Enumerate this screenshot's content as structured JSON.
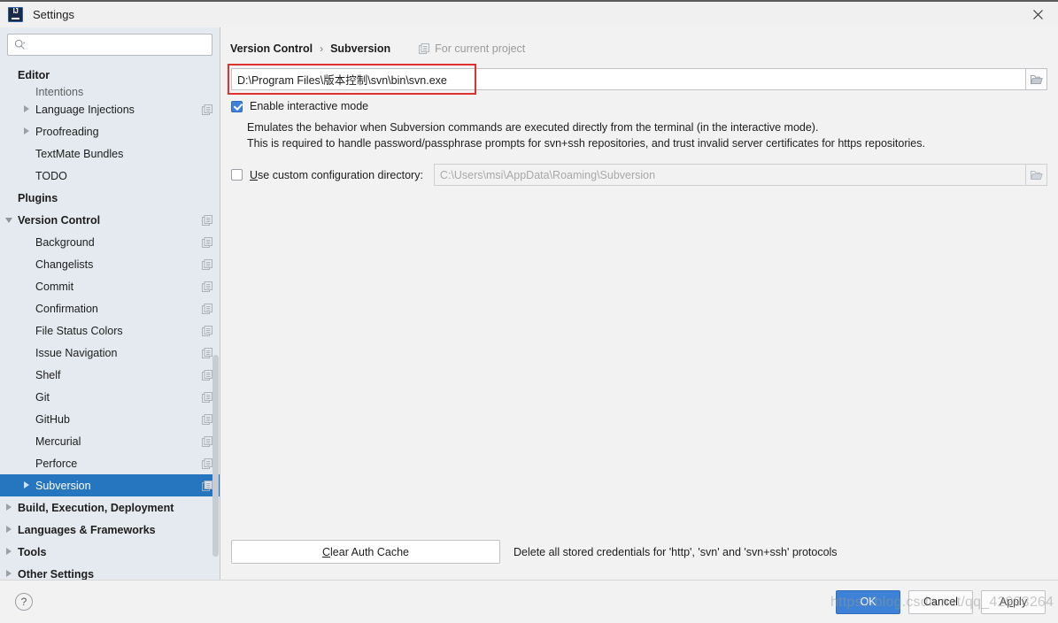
{
  "window": {
    "title": "Settings",
    "logo_icon": "intellij-idea-logo",
    "close_icon": "close-icon"
  },
  "sidebar": {
    "search": {
      "placeholder": "",
      "value": "",
      "icon": "search-icon"
    },
    "scope_icon": "project-scope-icon",
    "items": [
      {
        "label": "Editor",
        "level": 0,
        "arrow": "none",
        "bold": true,
        "scope": false,
        "selected": false
      },
      {
        "label": "Intentions",
        "level": 1,
        "arrow": "none",
        "bold": false,
        "scope": false,
        "selected": false,
        "clipped": true
      },
      {
        "label": "Language Injections",
        "level": 1,
        "arrow": "right",
        "bold": false,
        "scope": true,
        "selected": false
      },
      {
        "label": "Proofreading",
        "level": 1,
        "arrow": "right",
        "bold": false,
        "scope": false,
        "selected": false
      },
      {
        "label": "TextMate Bundles",
        "level": 1,
        "arrow": "none",
        "bold": false,
        "scope": false,
        "selected": false
      },
      {
        "label": "TODO",
        "level": 1,
        "arrow": "none",
        "bold": false,
        "scope": false,
        "selected": false
      },
      {
        "label": "Plugins",
        "level": 0,
        "arrow": "none",
        "bold": true,
        "scope": false,
        "selected": false
      },
      {
        "label": "Version Control",
        "level": 0,
        "arrow": "down",
        "bold": true,
        "scope": true,
        "selected": false
      },
      {
        "label": "Background",
        "level": 1,
        "arrow": "none",
        "bold": false,
        "scope": true,
        "selected": false
      },
      {
        "label": "Changelists",
        "level": 1,
        "arrow": "none",
        "bold": false,
        "scope": true,
        "selected": false
      },
      {
        "label": "Commit",
        "level": 1,
        "arrow": "none",
        "bold": false,
        "scope": true,
        "selected": false
      },
      {
        "label": "Confirmation",
        "level": 1,
        "arrow": "none",
        "bold": false,
        "scope": true,
        "selected": false
      },
      {
        "label": "File Status Colors",
        "level": 1,
        "arrow": "none",
        "bold": false,
        "scope": true,
        "selected": false
      },
      {
        "label": "Issue Navigation",
        "level": 1,
        "arrow": "none",
        "bold": false,
        "scope": true,
        "selected": false
      },
      {
        "label": "Shelf",
        "level": 1,
        "arrow": "none",
        "bold": false,
        "scope": true,
        "selected": false
      },
      {
        "label": "Git",
        "level": 1,
        "arrow": "none",
        "bold": false,
        "scope": true,
        "selected": false
      },
      {
        "label": "GitHub",
        "level": 1,
        "arrow": "none",
        "bold": false,
        "scope": true,
        "selected": false
      },
      {
        "label": "Mercurial",
        "level": 1,
        "arrow": "none",
        "bold": false,
        "scope": true,
        "selected": false
      },
      {
        "label": "Perforce",
        "level": 1,
        "arrow": "none",
        "bold": false,
        "scope": true,
        "selected": false
      },
      {
        "label": "Subversion",
        "level": 1,
        "arrow": "right",
        "bold": false,
        "scope": true,
        "selected": true
      },
      {
        "label": "Build, Execution, Deployment",
        "level": 0,
        "arrow": "right",
        "bold": true,
        "scope": false,
        "selected": false
      },
      {
        "label": "Languages & Frameworks",
        "level": 0,
        "arrow": "right",
        "bold": true,
        "scope": false,
        "selected": false
      },
      {
        "label": "Tools",
        "level": 0,
        "arrow": "right",
        "bold": true,
        "scope": false,
        "selected": false
      },
      {
        "label": "Other Settings",
        "level": 0,
        "arrow": "right",
        "bold": true,
        "scope": false,
        "selected": false
      }
    ]
  },
  "main": {
    "breadcrumb": {
      "parent": "Version Control",
      "separator": "›",
      "current": "Subversion",
      "scope_label": "For current project",
      "scope_icon": "project-scope-icon"
    },
    "svn_path": {
      "value": "D:\\Program Files\\版本控制\\svn\\bin\\svn.exe",
      "browse_icon": "folder-icon",
      "highlighted": true,
      "highlight_color": "#e03131"
    },
    "interactive_mode": {
      "label": "Enable interactive mode",
      "checked": true,
      "description_line1": "Emulates the behavior when Subversion commands are executed directly from the terminal (in the interactive mode).",
      "description_line2": "This is required to handle password/passphrase prompts for svn+ssh repositories, and trust invalid server certificates for https repositories."
    },
    "custom_config": {
      "label_pre": "",
      "label_mnemonic": "U",
      "label_post": "se custom configuration directory:",
      "checked": false,
      "value": "C:\\Users\\msi\\AppData\\Roaming\\Subversion",
      "browse_icon": "folder-icon"
    },
    "auth_cache": {
      "label_pre": "",
      "label_mnemonic": "C",
      "label_post": "lear Auth Cache",
      "note": "Delete all stored credentials for 'http', 'svn' and 'svn+ssh' protocols"
    }
  },
  "footer": {
    "help_label": "?",
    "help_icon": "help-icon",
    "ok_label": "OK",
    "cancel_label": "Cancel",
    "apply_label_pre": "A",
    "apply_mnemonic": "p",
    "apply_label_post": "ply"
  },
  "overlay": {
    "watermark": "https://blog.csdn.net/qq_42993264"
  },
  "colors": {
    "accent": "#2675bf",
    "checkbox": "#3d82d6",
    "sidebar_bg": "#e4eaef",
    "panel_bg": "#f2f2f2",
    "highlight_outline": "#e03131"
  }
}
